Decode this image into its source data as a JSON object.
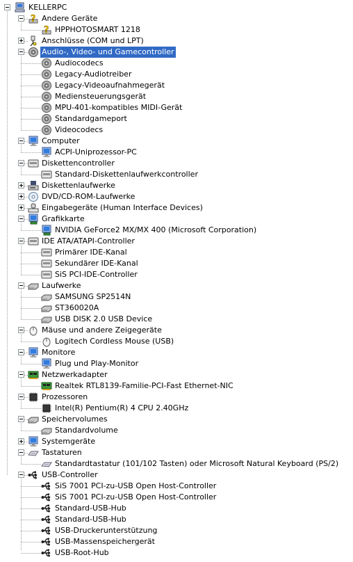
{
  "root": {
    "label": "KELLERPC",
    "icon": "computer-icon"
  },
  "colors": {
    "selection": "#316ac5",
    "treeLine": "#a0a0a0"
  },
  "categories": [
    {
      "label": "Andere Geräte",
      "icon": "unknown-device-icon",
      "expanded": true,
      "children": [
        {
          "label": "HPPHOTOSMART 1218",
          "icon": "unknown-device-icon"
        }
      ]
    },
    {
      "label": "Anschlüsse (COM und LPT)",
      "icon": "port-icon",
      "expanded": false,
      "children": []
    },
    {
      "label": "Audio-, Video- und Gamecontroller",
      "icon": "audio-icon",
      "expanded": true,
      "selected": true,
      "children": [
        {
          "label": "Audiocodecs",
          "icon": "audio-icon"
        },
        {
          "label": "Legacy-Audiotreiber",
          "icon": "audio-icon"
        },
        {
          "label": "Legacy-Videoaufnahmegerät",
          "icon": "audio-icon"
        },
        {
          "label": "Mediensteuerungsgerät",
          "icon": "audio-icon"
        },
        {
          "label": "MPU-401-kompatibles MIDI-Gerät",
          "icon": "audio-icon"
        },
        {
          "label": "Standardgameport",
          "icon": "audio-icon"
        },
        {
          "label": "Videocodecs",
          "icon": "audio-icon"
        }
      ]
    },
    {
      "label": "Computer",
      "icon": "monitor-icon",
      "expanded": true,
      "children": [
        {
          "label": "ACPI-Uniprozessor-PC",
          "icon": "monitor-icon"
        }
      ]
    },
    {
      "label": "Diskettencontroller",
      "icon": "controller-icon",
      "expanded": true,
      "children": [
        {
          "label": "Standard-Diskettenlaufwerkcontroller",
          "icon": "controller-icon"
        }
      ]
    },
    {
      "label": "Diskettenlaufwerke",
      "icon": "floppy-icon",
      "expanded": false,
      "children": []
    },
    {
      "label": "DVD/CD-ROM-Laufwerke",
      "icon": "cdrom-icon",
      "expanded": false,
      "children": []
    },
    {
      "label": "Eingabegeräte (Human Interface Devices)",
      "icon": "hid-icon",
      "expanded": false,
      "children": []
    },
    {
      "label": "Grafikkarte",
      "icon": "display-adapter-icon",
      "expanded": true,
      "children": [
        {
          "label": "NVIDIA GeForce2 MX/MX 400 (Microsoft Corporation)",
          "icon": "display-adapter-icon"
        }
      ]
    },
    {
      "label": "IDE ATA/ATAPI-Controller",
      "icon": "controller-icon",
      "expanded": true,
      "children": [
        {
          "label": "Primärer IDE-Kanal",
          "icon": "controller-icon"
        },
        {
          "label": "Sekundärer IDE-Kanal",
          "icon": "controller-icon"
        },
        {
          "label": "SiS PCI-IDE-Controller",
          "icon": "controller-icon"
        }
      ]
    },
    {
      "label": "Laufwerke",
      "icon": "disk-drive-icon",
      "expanded": true,
      "children": [
        {
          "label": "SAMSUNG SP2514N",
          "icon": "disk-drive-icon"
        },
        {
          "label": "ST360020A",
          "icon": "disk-drive-icon"
        },
        {
          "label": "USB DISK 2.0 USB Device",
          "icon": "disk-drive-icon"
        }
      ]
    },
    {
      "label": "Mäuse und andere Zeigegeräte",
      "icon": "mouse-icon",
      "expanded": true,
      "children": [
        {
          "label": "Logitech Cordless Mouse (USB)",
          "icon": "mouse-icon"
        }
      ]
    },
    {
      "label": "Monitore",
      "icon": "monitor-icon",
      "expanded": true,
      "children": [
        {
          "label": "Plug und Play-Monitor",
          "icon": "monitor-icon"
        }
      ]
    },
    {
      "label": "Netzwerkadapter",
      "icon": "network-card-icon",
      "expanded": true,
      "children": [
        {
          "label": "Realtek RTL8139-Familie-PCI-Fast Ethernet-NIC",
          "icon": "network-card-icon"
        }
      ]
    },
    {
      "label": "Prozessoren",
      "icon": "processor-icon",
      "expanded": true,
      "children": [
        {
          "label": "Intel(R) Pentium(R) 4 CPU 2.40GHz",
          "icon": "processor-icon"
        }
      ]
    },
    {
      "label": "Speichervolumes",
      "icon": "disk-drive-icon",
      "expanded": true,
      "children": [
        {
          "label": "Standardvolume",
          "icon": "disk-drive-icon"
        }
      ]
    },
    {
      "label": "Systemgeräte",
      "icon": "monitor-icon",
      "expanded": false,
      "children": []
    },
    {
      "label": "Tastaturen",
      "icon": "keyboard-icon",
      "expanded": true,
      "children": [
        {
          "label": "Standardtastatur (101/102 Tasten) oder Microsoft Natural Keyboard (PS/2)",
          "icon": "keyboard-icon"
        }
      ]
    },
    {
      "label": "USB-Controller",
      "icon": "usb-icon",
      "expanded": true,
      "children": [
        {
          "label": "SiS 7001 PCI-zu-USB Open Host-Controller",
          "icon": "usb-icon"
        },
        {
          "label": "SiS 7001 PCI-zu-USB Open Host-Controller",
          "icon": "usb-icon"
        },
        {
          "label": "Standard-USB-Hub",
          "icon": "usb-icon"
        },
        {
          "label": "Standard-USB-Hub",
          "icon": "usb-icon"
        },
        {
          "label": "USB-Druckerunterstützung",
          "icon": "usb-icon"
        },
        {
          "label": "USB-Massenspeichergerät",
          "icon": "usb-icon"
        },
        {
          "label": "USB-Root-Hub",
          "icon": "usb-icon"
        }
      ]
    }
  ]
}
